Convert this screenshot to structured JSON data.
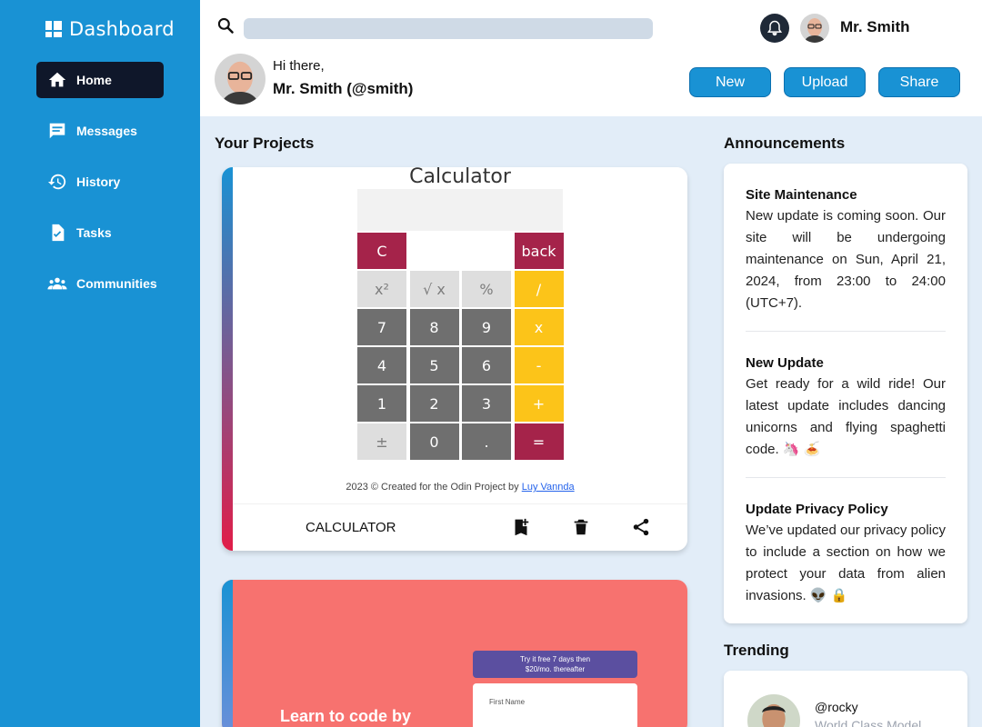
{
  "sidebar": {
    "brand": "Dashboard",
    "items": [
      {
        "label": "Home",
        "icon": "home-icon",
        "active": true
      },
      {
        "label": "Messages",
        "icon": "message-icon"
      },
      {
        "label": "History",
        "icon": "history-icon"
      },
      {
        "label": "Tasks",
        "icon": "task-icon"
      },
      {
        "label": "Communities",
        "icon": "communities-icon"
      }
    ]
  },
  "header": {
    "search_placeholder": "",
    "user_name": "Mr. Smith",
    "greeting": "Hi there,",
    "greeting_name": "Mr. Smith (@smith)",
    "buttons": {
      "new": "New",
      "upload": "Upload",
      "share": "Share"
    }
  },
  "projects": {
    "title": "Your Projects",
    "items": [
      {
        "name": "CALCULATOR",
        "preview": {
          "title": "Calculator",
          "keys": [
            "C",
            "back",
            "x²",
            "√ x",
            "%",
            "/",
            "7",
            "8",
            "9",
            "x",
            "4",
            "5",
            "6",
            "-",
            "1",
            "2",
            "3",
            "+",
            "±",
            "0",
            ".",
            "="
          ],
          "credit": "2023 © Created for the Odin Project by",
          "credit_link": "Luy Vannda"
        }
      },
      {
        "name": "",
        "preview": {
          "offer_line1": "Try it free 7 days then",
          "offer_line2": "$20/mo. thereafter",
          "field": "First Name",
          "headline": "Learn to code by"
        }
      }
    ]
  },
  "announcements": {
    "title": "Announcements",
    "items": [
      {
        "title": "Site Maintenance",
        "body": "New update is coming soon. Our site will be undergoing maintenance on Sun, April 21, 2024, from 23:00 to 24:00 (UTC+7)."
      },
      {
        "title": "New Update",
        "body": "Get ready for a wild ride! Our latest update includes dancing unicorns and flying spaghetti code. 🦄 🍝"
      },
      {
        "title": "Update Privacy Policy",
        "body": "We’ve updated our privacy policy to include a section on how we protect your data from alien invasions. 👽 🔒"
      }
    ]
  },
  "trending": {
    "title": "Trending",
    "items": [
      {
        "handle": "@rocky",
        "subtitle": "World Class Model"
      }
    ]
  },
  "colors": {
    "sidebar": "#1992d4",
    "active_nav": "#0f172a",
    "page_bg": "#e2edf8",
    "button": "#1992d4"
  }
}
